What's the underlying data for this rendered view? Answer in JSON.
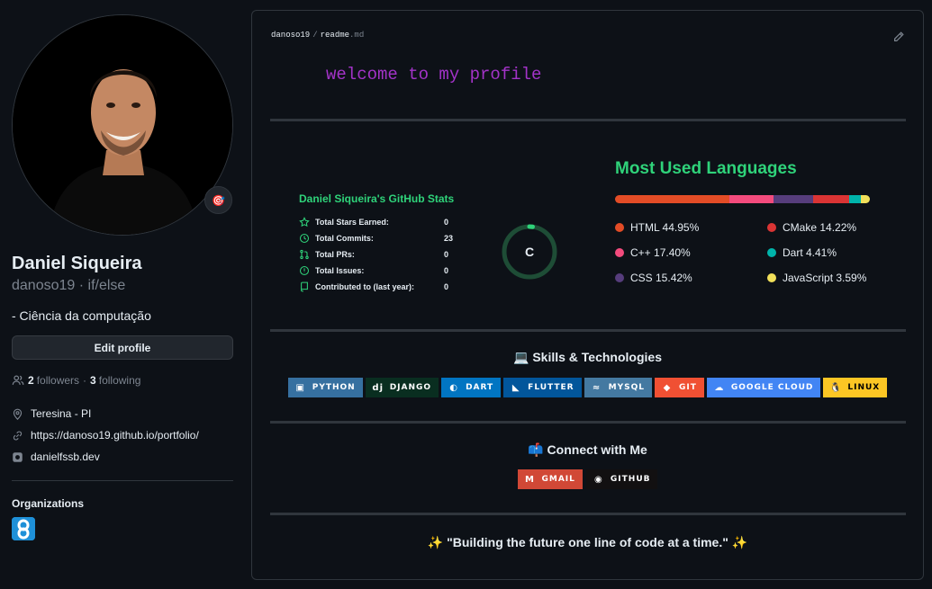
{
  "profile": {
    "name": "Daniel Siqueira",
    "login": "danoso19 · if/else",
    "bio": "- Ciência da computação",
    "edit_label": "Edit profile",
    "followers_count": "2",
    "followers_label": "followers",
    "following_count": "3",
    "following_label": "following",
    "location": "Teresina - PI",
    "website": "https://danoso19.github.io/portfolio/",
    "social": "danielfssb.dev",
    "orgs_title": "Organizations"
  },
  "readme": {
    "owner": "danoso19",
    "file": "readme",
    "ext": ".md",
    "welcome": "welcome to my profile"
  },
  "stats": {
    "title": "Daniel Siqueira's GitHub Stats",
    "rows": [
      {
        "label": "Total Stars Earned:",
        "value": "0",
        "icon": "star-icon"
      },
      {
        "label": "Total Commits:",
        "value": "23",
        "icon": "history-icon"
      },
      {
        "label": "Total PRs:",
        "value": "0",
        "icon": "pull-request-icon"
      },
      {
        "label": "Total Issues:",
        "value": "0",
        "icon": "issue-icon"
      },
      {
        "label": "Contributed to (last year):",
        "value": "0",
        "icon": "repo-icon"
      }
    ],
    "rank": "C",
    "rank_progress": 0.02
  },
  "languages": {
    "title": "Most Used Languages",
    "items": [
      {
        "name": "HTML",
        "percent": 44.95,
        "label": "HTML 44.95%",
        "color": "#e34c26"
      },
      {
        "name": "CMake",
        "percent": 14.22,
        "label": "CMake 14.22%",
        "color": "#da3434"
      },
      {
        "name": "C++",
        "percent": 17.4,
        "label": "C++ 17.40%",
        "color": "#f34b7d"
      },
      {
        "name": "Dart",
        "percent": 4.41,
        "label": "Dart 4.41%",
        "color": "#00b4ab"
      },
      {
        "name": "CSS",
        "percent": 15.42,
        "label": "CSS 15.42%",
        "color": "#563d7c"
      },
      {
        "name": "JavaScript",
        "percent": 3.59,
        "label": "JavaScript 3.59%",
        "color": "#f1e05a"
      }
    ]
  },
  "skills": {
    "title": "Skills & Technologies",
    "emoji": "💻",
    "badges": [
      {
        "label": "PYTHON",
        "color": "#3670a0",
        "icon": "python-icon",
        "glyph": "▣"
      },
      {
        "label": "DJANGO",
        "color": "#092e20",
        "icon": "django-icon",
        "glyph": "dj"
      },
      {
        "label": "DART",
        "color": "#0175c2",
        "icon": "dart-icon",
        "glyph": "◐"
      },
      {
        "label": "FLUTTER",
        "color": "#02569b",
        "icon": "flutter-icon",
        "glyph": "◣"
      },
      {
        "label": "MYSQL",
        "color": "#4479a1",
        "icon": "mysql-icon",
        "glyph": "≈"
      },
      {
        "label": "GIT",
        "color": "#f05033",
        "icon": "git-icon",
        "glyph": "◆"
      },
      {
        "label": "GOOGLE CLOUD",
        "color": "#4285f4",
        "icon": "cloud-icon",
        "glyph": "☁"
      },
      {
        "label": "LINUX",
        "color": "#fcc624",
        "icon": "linux-icon",
        "glyph": "🐧",
        "text_color": "#000000"
      }
    ]
  },
  "connect": {
    "title": "Connect with Me",
    "emoji": "📫",
    "badges": [
      {
        "label": "GMAIL",
        "color": "#d14836",
        "icon": "gmail-icon",
        "glyph": "M"
      },
      {
        "label": "GITHUB",
        "color": "#121011",
        "icon": "github-icon",
        "glyph": "◉"
      }
    ]
  },
  "quote": "✨ \"Building the future one line of code at a time.\" ✨"
}
